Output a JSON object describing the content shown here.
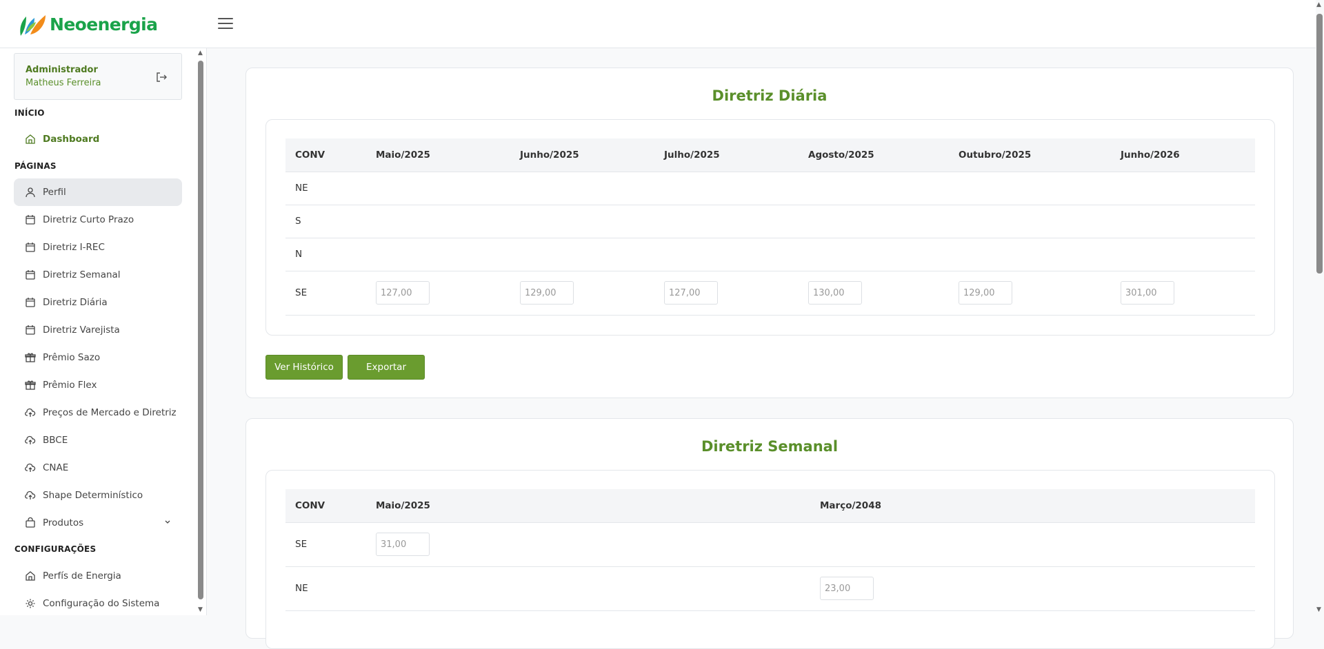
{
  "brand": {
    "name": "Neoenergia"
  },
  "user": {
    "role": "Administrador",
    "name": "Matheus Ferreira"
  },
  "sidebar": {
    "sections": [
      "INÍCIO",
      "PÁGINAS",
      "CONFIGURAÇÕES"
    ],
    "dashboard": "Dashboard",
    "items": [
      {
        "label": "Perfil",
        "icon": "user-icon"
      },
      {
        "label": "Diretriz Curto Prazo",
        "icon": "calendar-icon"
      },
      {
        "label": "Diretriz I-REC",
        "icon": "calendar-icon"
      },
      {
        "label": "Diretriz Semanal",
        "icon": "calendar-icon"
      },
      {
        "label": "Diretriz Diária",
        "icon": "calendar-icon"
      },
      {
        "label": "Diretriz Varejista",
        "icon": "calendar-icon"
      },
      {
        "label": "Prêmio Sazo",
        "icon": "gift-icon"
      },
      {
        "label": "Prêmio Flex",
        "icon": "gift-icon"
      },
      {
        "label": "Preços de Mercado e Diretriz",
        "icon": "cloud-upload-icon"
      },
      {
        "label": "BBCE",
        "icon": "cloud-upload-icon"
      },
      {
        "label": "CNAE",
        "icon": "cloud-upload-icon"
      },
      {
        "label": "Shape Determinístico",
        "icon": "cloud-upload-icon"
      },
      {
        "label": "Produtos",
        "icon": "shopping-bag-icon"
      }
    ],
    "config_items": [
      {
        "label": "Perfís de Energia",
        "icon": "home-icon"
      },
      {
        "label": "Configuração do Sistema",
        "icon": "gear-icon"
      }
    ]
  },
  "daily": {
    "title": "Diretriz Diária",
    "headers": [
      "CONV",
      "Maio/2025",
      "Junho/2025",
      "Julho/2025",
      "Agosto/2025",
      "Outubro/2025",
      "Junho/2026"
    ],
    "rows": [
      {
        "conv": "NE",
        "values": [
          "",
          "",
          "",
          "",
          "",
          ""
        ]
      },
      {
        "conv": "S",
        "values": [
          "",
          "",
          "",
          "",
          "",
          ""
        ]
      },
      {
        "conv": "N",
        "values": [
          "",
          "",
          "",
          "",
          "",
          ""
        ]
      },
      {
        "conv": "SE",
        "values": [
          "127,00",
          "129,00",
          "127,00",
          "130,00",
          "129,00",
          "301,00"
        ]
      }
    ],
    "buttons": {
      "history": "Ver Histórico",
      "export": "Exportar"
    }
  },
  "weekly": {
    "title": "Diretriz Semanal",
    "headers": [
      "CONV",
      "Maio/2025",
      "Março/2048"
    ],
    "rows": [
      {
        "conv": "SE",
        "values": [
          "31,00",
          ""
        ]
      },
      {
        "conv": "NE",
        "values": [
          "",
          "23,00"
        ]
      }
    ]
  },
  "colors": {
    "accent": "#5a8f2a",
    "button": "#6a9c2f",
    "brand": "#1aa34a"
  }
}
